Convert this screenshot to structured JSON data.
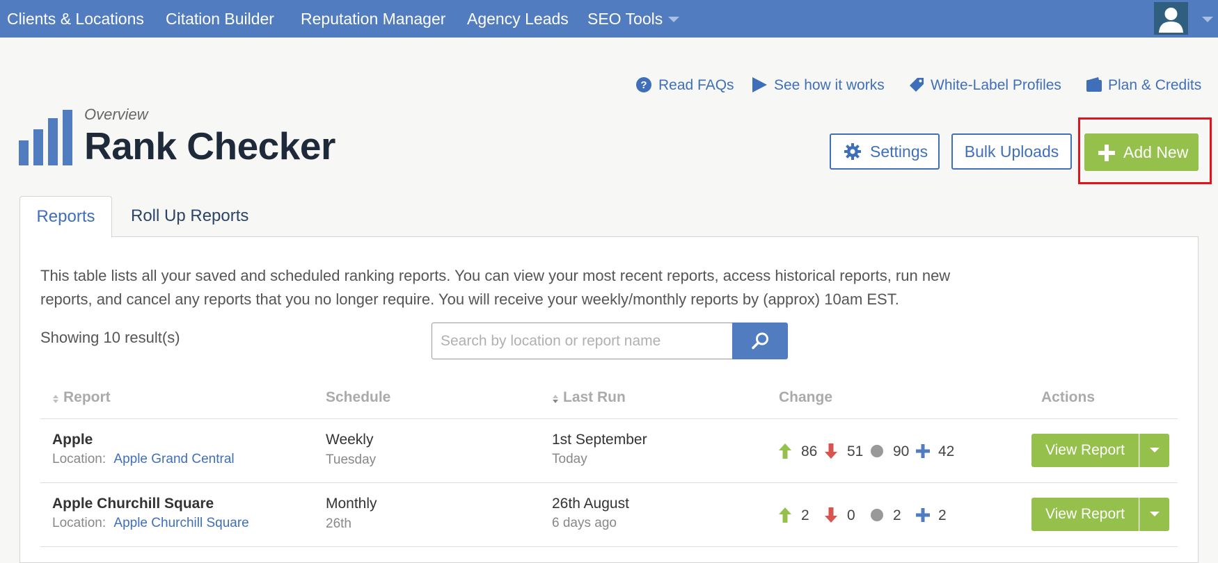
{
  "nav": {
    "items": [
      {
        "label": "Clients & Locations"
      },
      {
        "label": "Citation Builder"
      },
      {
        "label": "Reputation Manager"
      },
      {
        "label": "Agency Leads"
      },
      {
        "label": "SEO Tools"
      }
    ]
  },
  "help_links": {
    "faqs": "Read FAQs",
    "how": "See how it works",
    "white_label": "White-Label Profiles",
    "plan": "Plan & Credits"
  },
  "header": {
    "overline": "Overview",
    "title": "Rank Checker"
  },
  "toolbar": {
    "settings_label": "Settings",
    "bulk_label": "Bulk Uploads",
    "add_label": "Add New"
  },
  "tabs": [
    {
      "label": "Reports"
    },
    {
      "label": "Roll Up Reports"
    }
  ],
  "main": {
    "intro": "This table lists all your saved and scheduled ranking reports. You can view your most recent reports, access historical reports, run new reports, and cancel any reports that you no longer require. You will receive your weekly/monthly reports by (approx) 10am EST.",
    "showing": "Showing 10 result(s)",
    "search_placeholder": "Search by location or report name"
  },
  "table": {
    "headers": {
      "report": "Report",
      "schedule": "Schedule",
      "last_run": "Last Run",
      "change": "Change",
      "actions": "Actions"
    },
    "location_prefix": "Location:",
    "view_label": "View Report",
    "rows": [
      {
        "name": "Apple",
        "location": "Apple Grand Central",
        "schedule": "Weekly",
        "schedule_sub": "Tuesday",
        "last_run": "1st September",
        "last_run_sub": "Today",
        "up": "86",
        "down": "51",
        "same": "90",
        "new": "42"
      },
      {
        "name": "Apple Churchill Square",
        "location": "Apple Churchill Square",
        "schedule": "Monthly",
        "schedule_sub": "26th",
        "last_run": "26th August",
        "last_run_sub": "6 days ago",
        "up": "2",
        "down": "0",
        "same": "2",
        "new": "2"
      }
    ]
  },
  "colors": {
    "nav_bg": "#517cbf",
    "accent": "#3f6fb8",
    "success": "#94c04b",
    "danger": "#d9534f",
    "highlight": "#e3131d"
  }
}
